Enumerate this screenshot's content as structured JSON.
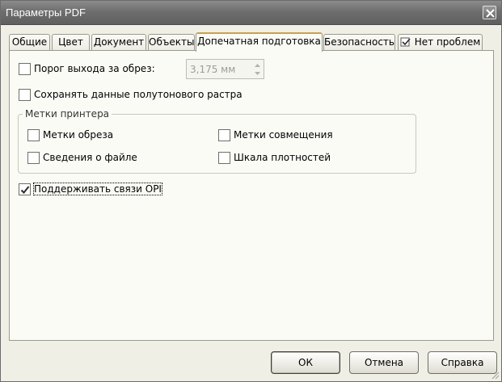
{
  "window": {
    "title": "Параметры PDF"
  },
  "tabs": [
    {
      "label": "Общие"
    },
    {
      "label": "Цвет"
    },
    {
      "label": "Документ"
    },
    {
      "label": "Объекты"
    },
    {
      "label": "Допечатная подготовка"
    },
    {
      "label": "Безопасность"
    },
    {
      "label": "Нет проблем",
      "icon": "check-document-icon"
    }
  ],
  "active_tab": "Допечатная подготовка",
  "bleed": {
    "label": "Порог выхода за обрез:",
    "checked": false,
    "value": "3,175 мм"
  },
  "halftone": {
    "label": "Сохранять данные полутонового растра",
    "checked": false
  },
  "printer_marks": {
    "title": "Метки принтера",
    "crop_marks": {
      "label": "Метки обреза",
      "checked": false
    },
    "registration_marks": {
      "label": "Метки совмещения",
      "checked": false
    },
    "file_info": {
      "label": "Сведения о файле",
      "checked": false
    },
    "density_scale": {
      "label": "Шкала плотностей",
      "checked": false
    }
  },
  "opi": {
    "label": "Поддерживать связи OPI",
    "checked": true
  },
  "buttons": {
    "ok": "ОК",
    "cancel": "Отмена",
    "help": "Справка"
  }
}
